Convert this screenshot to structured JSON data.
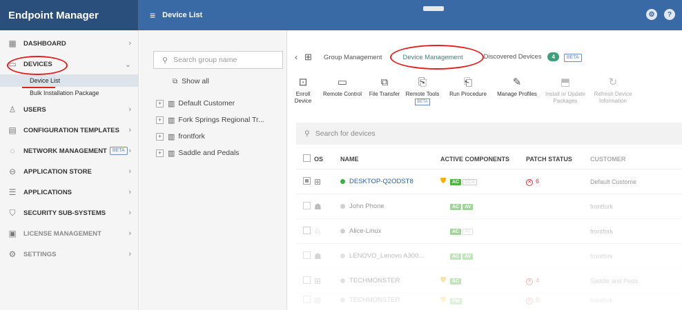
{
  "app": {
    "brand": "Endpoint Manager",
    "page_title": "Device List"
  },
  "topbar": {
    "menu_icon": "hamburger-menu-icon",
    "right_icons": [
      "gear-icon",
      "help-icon"
    ]
  },
  "sidebar": {
    "items": [
      {
        "label": "DASHBOARD",
        "icon": "dashboard-icon"
      },
      {
        "label": "DEVICES",
        "icon": "devices-icon"
      },
      {
        "label": "USERS",
        "icon": "user-icon"
      },
      {
        "label": "CONFIGURATION TEMPLATES",
        "icon": "template-icon"
      },
      {
        "label": "NETWORK MANAGEMENT",
        "icon": "network-icon",
        "badge": "BETA"
      },
      {
        "label": "APPLICATION STORE",
        "icon": "store-icon"
      },
      {
        "label": "APPLICATIONS",
        "icon": "applications-icon"
      },
      {
        "label": "SECURITY SUB-SYSTEMS",
        "icon": "shield-icon"
      },
      {
        "label": "LICENSE MANAGEMENT",
        "icon": "license-icon"
      },
      {
        "label": "SETTINGS",
        "icon": "settings-icon"
      }
    ],
    "devices_sub": [
      "Device List",
      "Bulk Installation Package"
    ]
  },
  "groups": {
    "search_placeholder": "Search group name",
    "show_all": "Show all",
    "items": [
      "Default Customer",
      "Fork Springs Regional Tr...",
      "frontfork",
      "Saddle and Pedals"
    ]
  },
  "tabs": {
    "group_management": "Group Management",
    "device_management": "Device Management",
    "discovered_devices": "Discovered Devices",
    "discovered_count": "4",
    "beta": "BETA"
  },
  "toolbar": {
    "enroll": "Enroll Device",
    "remote_control": "Remote Control",
    "file_transfer": "File Transfer",
    "remote_tools": "Remote Tools",
    "remote_tools_badge": "BETA",
    "run_procedure": "Run Procedure",
    "manage_profiles": "Manage Profiles",
    "install_update_1": "Install or Update",
    "install_update_2": "Packages",
    "refresh_1": "Refresh Device",
    "refresh_2": "Information"
  },
  "devices": {
    "search_placeholder": "Search for devices",
    "columns": {
      "os": "OS",
      "name": "NAME",
      "components": "ACTIVE COMPONENTS",
      "patch": "PATCH STATUS",
      "customer": "CUSTOMER"
    },
    "rows": [
      {
        "name": "DESKTOP-Q2ODST8",
        "patch": "6",
        "customer": "Default Custome"
      },
      {
        "name": "John Phone",
        "patch": "",
        "customer": "frontfork"
      },
      {
        "name": "Alice-Linux",
        "patch": "",
        "customer": "frontfork"
      },
      {
        "name": "LENOVO_Lenovo A300...",
        "patch": "",
        "customer": "frontfork"
      },
      {
        "name": "TECHMONSTER",
        "patch": "4",
        "customer": "Saddle and Peda"
      },
      {
        "name": "TECHMONSTER",
        "patch": "5",
        "customer": "frontfork"
      }
    ],
    "badges": {
      "ac": "AC",
      "av": "AV",
      "ccs": "CCS",
      "fw": "FW"
    }
  }
}
